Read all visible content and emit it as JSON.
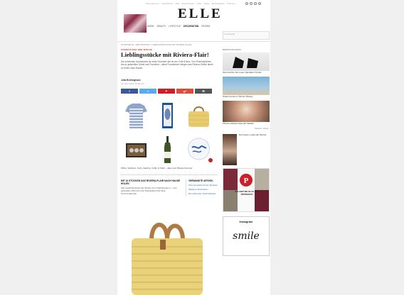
{
  "header": {
    "top_links": "Abonnement · Newsletter · Wer · Ergebnisse · Jobs · Shop · Mediadaten · Themen",
    "logo": "ELLE",
    "search_placeholder": "Suchbegriff",
    "nav": [
      "MODE",
      "BEAUTY",
      "LIFESTYLE",
      "DECORATION",
      "REISEN"
    ]
  },
  "article": {
    "breadcrumb": "STARTSEITE › DECORATION › LIEBLINGSSTÜCKE MIT RIVIERA-FLAIR",
    "kicker": "FUNDSTÜCKE DER WOCHE",
    "title": "Lieblingsstücke mit Riviera-Flair!",
    "intro": "Die schönsten Accessoires für einen Sommer wie an der Côte d'Azur: Von Picknickkörben bis zu gestreiften Shirts und Porzellan – diese Fundstücke bringen das Riviera-Gefühl direkt zu Ihnen nach Hause.",
    "author": "Julia Brüninghaus",
    "date": "24. Juni 2014, 10:00 Uhr",
    "share": [
      {
        "label": "f",
        "color": "#3b5998"
      },
      {
        "label": "t",
        "color": "#55acee"
      },
      {
        "label": "P",
        "color": "#cb2027"
      },
      {
        "label": "g+",
        "color": "#dd4b39"
      },
      {
        "label": "✉",
        "color": "#555555"
      }
    ],
    "caption": "Shirts, Sardinen, Korb, Flasche, Koffer & Teller – alles zum Riviera-Sommer",
    "box_title": "MIT 10 STÜCKEN DAS RIVIERA-FLAIR NACH HAUSE HOLEN",
    "box_text": "Alle Lieblingsstücke der Woche zum Nachshoppen – vom gestreiften Shirt bis zum Picknickkorb für laue Sommerabende.",
    "related_title": "VERWANDTE ARTIKEL",
    "related": [
      "Sommer-Deko für die Terrasse",
      "Maritime Wohnideen",
      "Die schönsten Picknickkörbe"
    ]
  },
  "sidebar": {
    "head": "MEISTGELESEN",
    "items": [
      "Sommerhits: die neuen Sandalen-Trends",
      "Strand-Looks im Stil der Riviera",
      "Fitness-Geheimnisse der Models"
    ],
    "more": "Weitere Artikel ›",
    "promo_text": "Die besten Looks der Woche",
    "pinterest_label": "FOLGEN SIE ELLE AUF PINTEREST",
    "instagram_label": "Instagram",
    "smile": "smile"
  }
}
